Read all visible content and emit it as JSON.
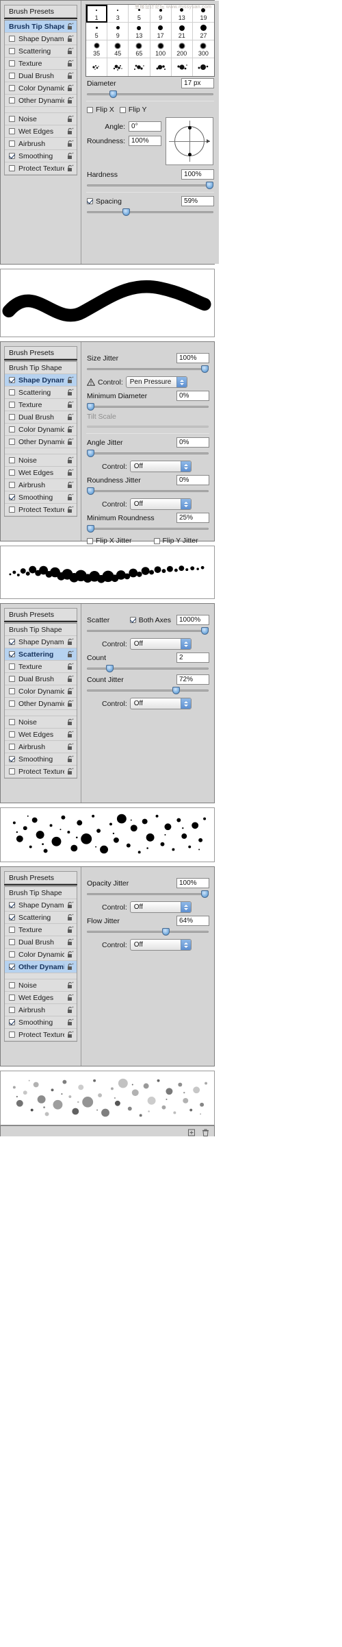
{
  "watermark": "思缘设计论坛  www.missyuan.com",
  "panels": [
    {
      "id": "brush-tip-shape",
      "left_list": {
        "presets_label": "Brush Presets",
        "items": [
          {
            "label": "Brush Tip Shape",
            "checkbox": null,
            "selected": true,
            "bold": true,
            "lock": true
          },
          {
            "label": "Shape Dynamics",
            "checkbox": false,
            "selected": false,
            "bold": false,
            "lock": true
          },
          {
            "label": "Scattering",
            "checkbox": false,
            "selected": false,
            "bold": false,
            "lock": true
          },
          {
            "label": "Texture",
            "checkbox": false,
            "selected": false,
            "bold": false,
            "lock": true
          },
          {
            "label": "Dual Brush",
            "checkbox": false,
            "selected": false,
            "bold": false,
            "lock": true
          },
          {
            "label": "Color Dynamics",
            "checkbox": false,
            "selected": false,
            "bold": false,
            "lock": true
          },
          {
            "label": "Other Dynamics",
            "checkbox": false,
            "selected": false,
            "bold": false,
            "lock": true
          },
          {
            "label": "Noise",
            "checkbox": false,
            "selected": false,
            "bold": false,
            "lock": true,
            "gap_before": true
          },
          {
            "label": "Wet Edges",
            "checkbox": false,
            "selected": false,
            "bold": false,
            "lock": true
          },
          {
            "label": "Airbrush",
            "checkbox": false,
            "selected": false,
            "bold": false,
            "lock": true
          },
          {
            "label": "Smoothing",
            "checkbox": true,
            "selected": false,
            "bold": false,
            "lock": true
          },
          {
            "label": "Protect Texture",
            "checkbox": false,
            "selected": false,
            "bold": false,
            "lock": true
          }
        ]
      },
      "brush_grid": {
        "selected_index": 0,
        "cells": [
          {
            "size": "1",
            "dot": 2
          },
          {
            "size": "3",
            "dot": 2
          },
          {
            "size": "5",
            "dot": 3
          },
          {
            "size": "9",
            "dot": 4
          },
          {
            "size": "13",
            "dot": 5
          },
          {
            "size": "19",
            "dot": 6
          },
          {
            "size": "5",
            "dot": 3
          },
          {
            "size": "9",
            "dot": 5
          },
          {
            "size": "13",
            "dot": 6
          },
          {
            "size": "17",
            "dot": 7
          },
          {
            "size": "21",
            "dot": 8
          },
          {
            "size": "27",
            "dot": 9
          },
          {
            "size": "35",
            "dot": 9
          },
          {
            "size": "45",
            "dot": 10
          },
          {
            "size": "65",
            "dot": 10
          },
          {
            "size": "100",
            "dot": 10
          },
          {
            "size": "200",
            "dot": 10
          },
          {
            "size": "300",
            "dot": 10
          }
        ]
      },
      "controls": {
        "diameter_label": "Diameter",
        "diameter_value": "17 px",
        "diameter_pct": 20,
        "flip_x_label": "Flip X",
        "flip_x_checked": false,
        "flip_y_label": "Flip Y",
        "flip_y_checked": false,
        "angle_label": "Angle:",
        "angle_value": "0°",
        "roundness_label": "Roundness:",
        "roundness_value": "100%",
        "hardness_label": "Hardness",
        "hardness_value": "100%",
        "hardness_pct": 100,
        "spacing_label": "Spacing",
        "spacing_checked": true,
        "spacing_value": "59%",
        "spacing_pct": 30
      }
    },
    {
      "id": "shape-dynamics",
      "left_list": {
        "presets_label": "Brush Presets",
        "items": [
          {
            "label": "Brush Tip Shape",
            "checkbox": null,
            "selected": false,
            "bold": false,
            "lock": false
          },
          {
            "label": "Shape Dynamics",
            "checkbox": true,
            "selected": true,
            "bold": true,
            "lock": true
          },
          {
            "label": "Scattering",
            "checkbox": false,
            "selected": false,
            "bold": false,
            "lock": true
          },
          {
            "label": "Texture",
            "checkbox": false,
            "selected": false,
            "bold": false,
            "lock": true
          },
          {
            "label": "Dual Brush",
            "checkbox": false,
            "selected": false,
            "bold": false,
            "lock": true
          },
          {
            "label": "Color Dynamics",
            "checkbox": false,
            "selected": false,
            "bold": false,
            "lock": true
          },
          {
            "label": "Other Dynamics",
            "checkbox": false,
            "selected": false,
            "bold": false,
            "lock": true
          },
          {
            "label": "Noise",
            "checkbox": false,
            "selected": false,
            "bold": false,
            "lock": true,
            "gap_before": true
          },
          {
            "label": "Wet Edges",
            "checkbox": false,
            "selected": false,
            "bold": false,
            "lock": true
          },
          {
            "label": "Airbrush",
            "checkbox": false,
            "selected": false,
            "bold": false,
            "lock": true
          },
          {
            "label": "Smoothing",
            "checkbox": true,
            "selected": false,
            "bold": false,
            "lock": true
          },
          {
            "label": "Protect Texture",
            "checkbox": false,
            "selected": false,
            "bold": false,
            "lock": true
          }
        ]
      },
      "controls": {
        "size_jitter_label": "Size Jitter",
        "size_jitter_value": "100%",
        "size_jitter_pct": 100,
        "control1_label": "Control:",
        "control1_value": "Pen Pressure",
        "control1_warning": true,
        "min_diameter_label": "Minimum Diameter",
        "min_diameter_value": "0%",
        "min_diameter_pct": 0,
        "tilt_scale_label": "Tilt Scale",
        "tilt_scale_disabled": true,
        "angle_jitter_label": "Angle Jitter",
        "angle_jitter_value": "0%",
        "angle_jitter_pct": 0,
        "control2_label": "Control:",
        "control2_value": "Off",
        "roundness_jitter_label": "Roundness Jitter",
        "roundness_jitter_value": "0%",
        "roundness_jitter_pct": 0,
        "control3_label": "Control:",
        "control3_value": "Off",
        "min_roundness_label": "Minimum Roundness",
        "min_roundness_value": "25%",
        "min_roundness_pct": 25,
        "flip_x_jitter_label": "Flip X Jitter",
        "flip_x_jitter_checked": false,
        "flip_y_jitter_label": "Flip Y Jitter",
        "flip_y_jitter_checked": false
      }
    },
    {
      "id": "scattering",
      "left_list": {
        "presets_label": "Brush Presets",
        "items": [
          {
            "label": "Brush Tip Shape",
            "checkbox": null,
            "selected": false,
            "bold": false,
            "lock": false
          },
          {
            "label": "Shape Dynamics",
            "checkbox": true,
            "selected": false,
            "bold": false,
            "lock": true
          },
          {
            "label": "Scattering",
            "checkbox": true,
            "selected": true,
            "bold": true,
            "lock": true
          },
          {
            "label": "Texture",
            "checkbox": false,
            "selected": false,
            "bold": false,
            "lock": true
          },
          {
            "label": "Dual Brush",
            "checkbox": false,
            "selected": false,
            "bold": false,
            "lock": true
          },
          {
            "label": "Color Dynamics",
            "checkbox": false,
            "selected": false,
            "bold": false,
            "lock": true
          },
          {
            "label": "Other Dynamics",
            "checkbox": false,
            "selected": false,
            "bold": false,
            "lock": true
          },
          {
            "label": "Noise",
            "checkbox": false,
            "selected": false,
            "bold": false,
            "lock": true,
            "gap_before": true
          },
          {
            "label": "Wet Edges",
            "checkbox": false,
            "selected": false,
            "bold": false,
            "lock": true
          },
          {
            "label": "Airbrush",
            "checkbox": false,
            "selected": false,
            "bold": false,
            "lock": true
          },
          {
            "label": "Smoothing",
            "checkbox": true,
            "selected": false,
            "bold": false,
            "lock": true
          },
          {
            "label": "Protect Texture",
            "checkbox": false,
            "selected": false,
            "bold": false,
            "lock": true
          }
        ]
      },
      "controls": {
        "scatter_label": "Scatter",
        "both_axes_label": "Both Axes",
        "both_axes_checked": true,
        "scatter_value": "1000%",
        "scatter_pct": 100,
        "control1_label": "Control:",
        "control1_value": "Off",
        "count_label": "Count",
        "count_value": "2",
        "count_pct": 10,
        "count_jitter_label": "Count Jitter",
        "count_jitter_value": "72%",
        "count_jitter_pct": 72,
        "control2_label": "Control:",
        "control2_value": "Off"
      }
    },
    {
      "id": "other-dynamics",
      "left_list": {
        "presets_label": "Brush Presets",
        "items": [
          {
            "label": "Brush Tip Shape",
            "checkbox": null,
            "selected": false,
            "bold": false,
            "lock": false
          },
          {
            "label": "Shape Dynamics",
            "checkbox": true,
            "selected": false,
            "bold": false,
            "lock": true
          },
          {
            "label": "Scattering",
            "checkbox": true,
            "selected": false,
            "bold": false,
            "lock": true
          },
          {
            "label": "Texture",
            "checkbox": false,
            "selected": false,
            "bold": false,
            "lock": true
          },
          {
            "label": "Dual Brush",
            "checkbox": false,
            "selected": false,
            "bold": false,
            "lock": true
          },
          {
            "label": "Color Dynamics",
            "checkbox": false,
            "selected": false,
            "bold": false,
            "lock": true
          },
          {
            "label": "Other Dynamics",
            "checkbox": true,
            "selected": true,
            "bold": true,
            "lock": true
          },
          {
            "label": "Noise",
            "checkbox": false,
            "selected": false,
            "bold": false,
            "lock": true,
            "gap_before": true
          },
          {
            "label": "Wet Edges",
            "checkbox": false,
            "selected": false,
            "bold": false,
            "lock": true
          },
          {
            "label": "Airbrush",
            "checkbox": false,
            "selected": false,
            "bold": false,
            "lock": true
          },
          {
            "label": "Smoothing",
            "checkbox": true,
            "selected": false,
            "bold": false,
            "lock": true
          },
          {
            "label": "Protect Texture",
            "checkbox": false,
            "selected": false,
            "bold": false,
            "lock": true
          }
        ]
      },
      "controls": {
        "opacity_jitter_label": "Opacity Jitter",
        "opacity_jitter_value": "100%",
        "opacity_jitter_pct": 100,
        "control1_label": "Control:",
        "control1_value": "Off",
        "flow_jitter_label": "Flow Jitter",
        "flow_jitter_value": "64%",
        "flow_jitter_pct": 64,
        "control2_label": "Control:",
        "control2_value": "Off"
      }
    }
  ],
  "previews": [
    {
      "id": "preview-solid-stroke",
      "style": "solid-wave"
    },
    {
      "id": "preview-size-jitter-stroke",
      "style": "jitter-wave"
    },
    {
      "id": "preview-scatter-stroke",
      "style": "scatter"
    },
    {
      "id": "preview-opacity-scatter-stroke",
      "style": "scatter-gray"
    }
  ],
  "icons": {
    "lock": "lock-icon",
    "warning": "warning-triangle-icon",
    "new_brush": "new-brush-icon",
    "trash": "trash-icon",
    "menu": "panel-menu-icon"
  }
}
